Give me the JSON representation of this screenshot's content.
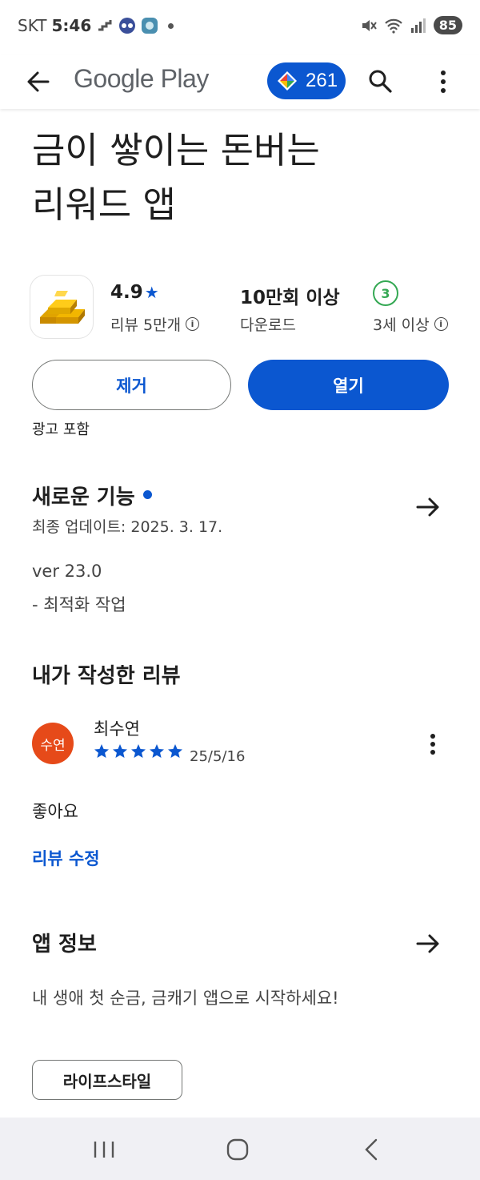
{
  "status_bar": {
    "carrier": "SKT",
    "time": "5:46",
    "battery": "85"
  },
  "app_bar": {
    "brand": "Google Play",
    "points": "261"
  },
  "app": {
    "title_line1": "금이 쌓이는 돈버는",
    "title_line2": "리워드 앱",
    "rating": "4.9",
    "reviews_label": "리뷰 5만개",
    "downloads": "10만회 이상",
    "downloads_label": "다운로드",
    "age_badge": "3",
    "age_label": "3세 이상"
  },
  "actions": {
    "remove_label": "제거",
    "open_label": "열기",
    "ads_note": "광고 포함"
  },
  "whats_new": {
    "title": "새로운 기능",
    "last_updated": "최종 업데이트: 2025. 3. 17.",
    "version": "ver 23.0",
    "notes": "- 최적화 작업"
  },
  "my_review": {
    "title": "내가 작성한 리뷰",
    "avatar_text": "수연",
    "reviewer": "최수연",
    "stars": 5,
    "date": "25/5/16",
    "text": "좋아요",
    "edit_label": "리뷰 수정"
  },
  "about": {
    "title": "앱 정보",
    "description": "내 생애 첫 순금, 금캐기 앱으로 시작하세요!",
    "category_chip": "라이프스타일"
  },
  "colors": {
    "accent": "#0b57d0",
    "avatar": "#e64a19",
    "age_green": "#34a853"
  },
  "icons": [
    "back-arrow-icon",
    "play-points-icon",
    "search-icon",
    "more-vert-icon",
    "star-icon",
    "info-icon",
    "arrow-right-icon",
    "gold-bars-icon"
  ]
}
